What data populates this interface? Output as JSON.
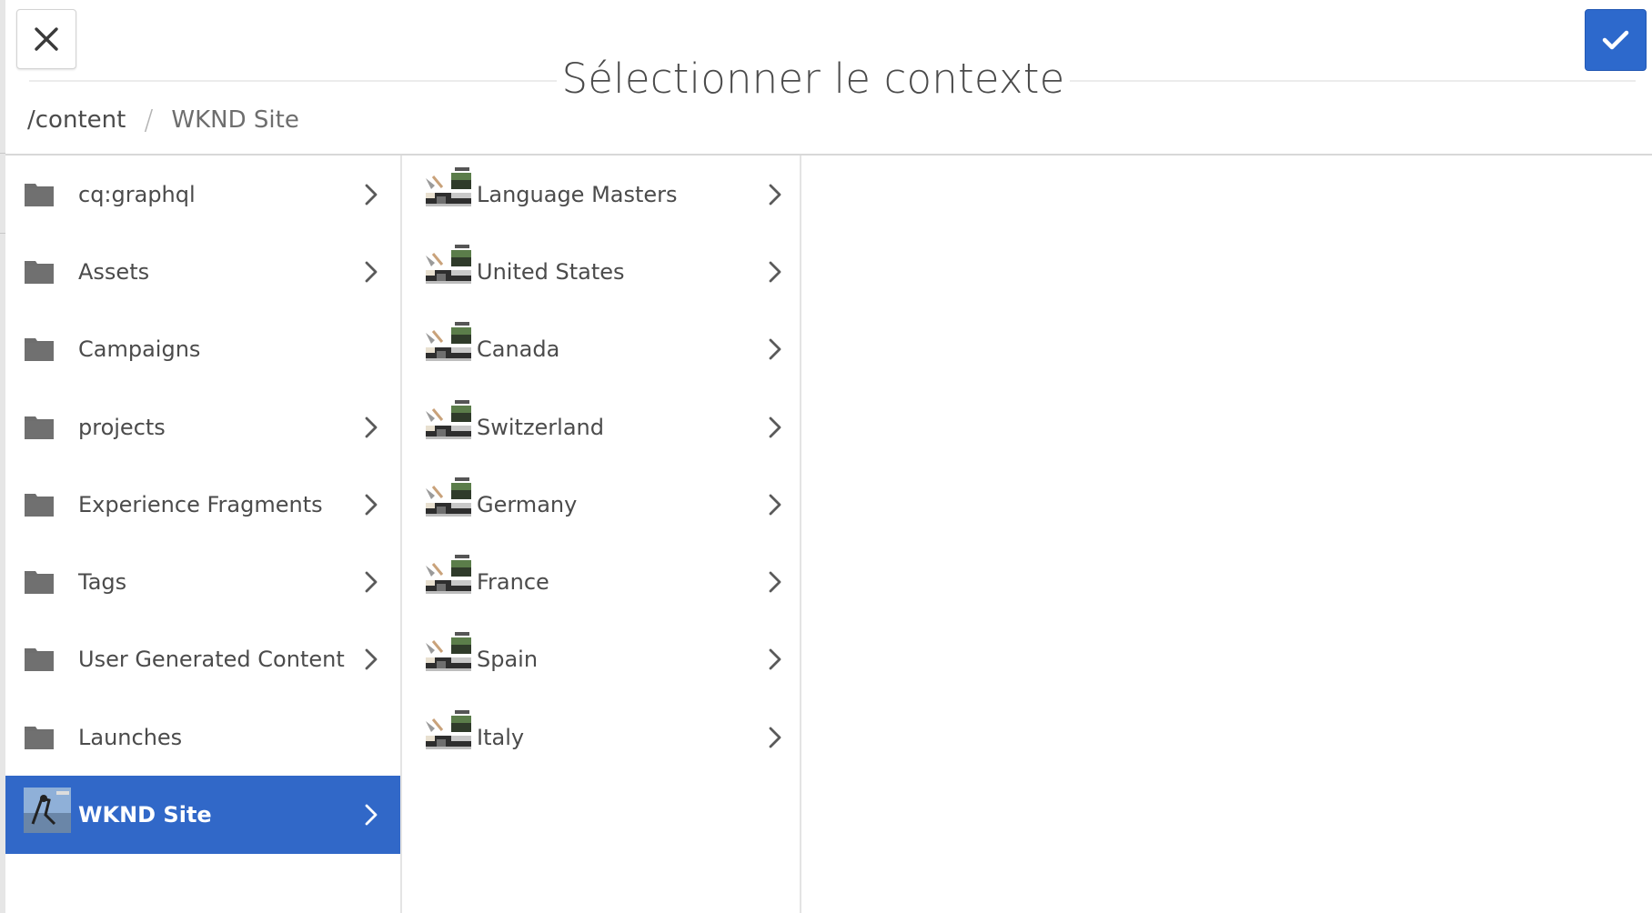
{
  "dialog": {
    "title": "Sélectionner le contexte",
    "close_icon": "close-icon",
    "confirm_icon": "checkmark-icon",
    "accent_color": "#2d69cc"
  },
  "breadcrumb": {
    "root": "/content",
    "separator": "/",
    "current": "WKND Site"
  },
  "column_1": {
    "items": [
      {
        "label": "cq:graphql",
        "icon": "folder-icon",
        "has_children": true,
        "selected": false
      },
      {
        "label": "Assets",
        "icon": "folder-icon",
        "has_children": true,
        "selected": false
      },
      {
        "label": "Campaigns",
        "icon": "folder-icon",
        "has_children": false,
        "selected": false
      },
      {
        "label": "projects",
        "icon": "folder-icon",
        "has_children": true,
        "selected": false
      },
      {
        "label": "Experience Fragments",
        "icon": "folder-icon",
        "has_children": true,
        "selected": false
      },
      {
        "label": "Tags",
        "icon": "folder-icon",
        "has_children": true,
        "selected": false
      },
      {
        "label": "User Generated Content",
        "icon": "folder-icon",
        "has_children": true,
        "selected": false
      },
      {
        "label": "Launches",
        "icon": "folder-icon",
        "has_children": false,
        "selected": false
      },
      {
        "label": "WKND Site",
        "icon": "site-thumbnail-icon",
        "has_children": true,
        "selected": true
      }
    ]
  },
  "column_2": {
    "items": [
      {
        "label": "Language Masters",
        "icon": "page-thumbnail-icon",
        "has_children": true
      },
      {
        "label": "United States",
        "icon": "page-thumbnail-icon",
        "has_children": true
      },
      {
        "label": "Canada",
        "icon": "page-thumbnail-icon",
        "has_children": true
      },
      {
        "label": "Switzerland",
        "icon": "page-thumbnail-icon",
        "has_children": true
      },
      {
        "label": "Germany",
        "icon": "page-thumbnail-icon",
        "has_children": true
      },
      {
        "label": "France",
        "icon": "page-thumbnail-icon",
        "has_children": true
      },
      {
        "label": "Spain",
        "icon": "page-thumbnail-icon",
        "has_children": true
      },
      {
        "label": "Italy",
        "icon": "page-thumbnail-icon",
        "has_children": true
      }
    ]
  }
}
